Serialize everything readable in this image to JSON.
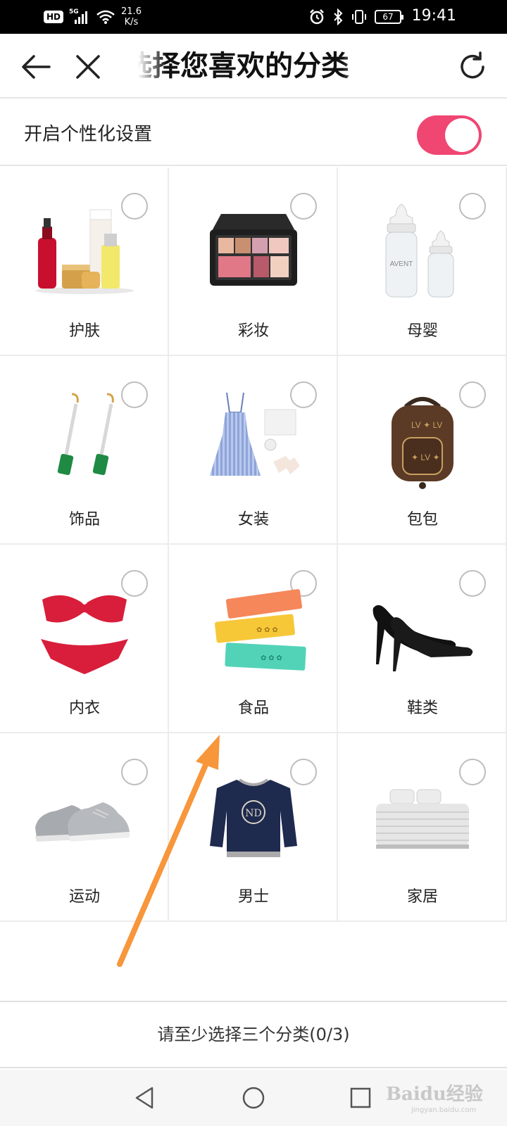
{
  "status_bar": {
    "hd": "HD",
    "network": "5G",
    "speed_value": "21.6",
    "speed_unit": "K/s",
    "battery": "67",
    "time": "19:41"
  },
  "nav": {
    "title": "选择您喜欢的分类"
  },
  "personalization": {
    "label": "开启个性化设置",
    "enabled": true,
    "toggle_color": "#f04672"
  },
  "categories": [
    {
      "label": "护肤",
      "icon": "skincare-products-icon",
      "selected": false
    },
    {
      "label": "彩妆",
      "icon": "makeup-palette-icon",
      "selected": false
    },
    {
      "label": "母婴",
      "icon": "baby-bottle-icon",
      "selected": false
    },
    {
      "label": "饰品",
      "icon": "earrings-icon",
      "selected": false
    },
    {
      "label": "女装",
      "icon": "dress-icon",
      "selected": false
    },
    {
      "label": "包包",
      "icon": "backpack-icon",
      "selected": false
    },
    {
      "label": "内衣",
      "icon": "bikini-icon",
      "selected": false
    },
    {
      "label": "食品",
      "icon": "snack-bars-icon",
      "selected": false
    },
    {
      "label": "鞋类",
      "icon": "high-heels-icon",
      "selected": false
    },
    {
      "label": "运动",
      "icon": "sneakers-icon",
      "selected": false
    },
    {
      "label": "男士",
      "icon": "sweatshirt-icon",
      "selected": false
    },
    {
      "label": "家居",
      "icon": "bed-icon",
      "selected": false
    }
  ],
  "bottom_button": {
    "label": "请至少选择三个分类(0/3)"
  },
  "watermark": {
    "brand": "Baidu经验",
    "url": "jingyan.baidu.com"
  },
  "annotation_color": "#f7963a"
}
